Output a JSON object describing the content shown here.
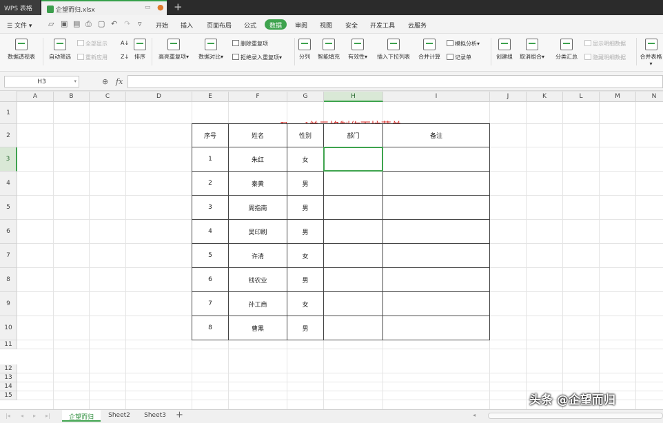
{
  "titlebar": {
    "app_name": "WPS 表格",
    "file_name": "企望而归.xlsx",
    "new_tab": "+"
  },
  "menu": {
    "file_label": "文件",
    "items": [
      "开始",
      "插入",
      "页面布局",
      "公式",
      "数据",
      "审阅",
      "视图",
      "安全",
      "开发工具",
      "云服务"
    ],
    "active": "数据"
  },
  "ribbon": {
    "pivot": "数据透视表",
    "autofilter": "自动筛选",
    "show_all": "全部显示",
    "reapply": "重新应用",
    "sort": "排序",
    "highlight_dup": "高亮重复项",
    "compare": "数据对比",
    "delete_dup": "删除重复项",
    "reject_dup": "拒绝录入重复项",
    "split": "分列",
    "smart_fill": "智能填充",
    "validity": "有效性",
    "insert_dropdown": "插入下拉列表",
    "consolidate": "合并计算",
    "simulate": "模拟分析",
    "record": "记录单",
    "create_group": "创建组",
    "ungroup": "取消组合",
    "subtotal": "分类汇总",
    "show_detail": "显示明细数据",
    "hide_detail": "隐藏明细数据",
    "merge_tables": "合并表格"
  },
  "formula_bar": {
    "cell_ref": "H3",
    "fx": "fx",
    "value": ""
  },
  "columns": [
    "A",
    "B",
    "C",
    "D",
    "E",
    "F",
    "G",
    "H",
    "I",
    "J",
    "K",
    "L",
    "M",
    "N"
  ],
  "rows": [
    "1",
    "2",
    "3",
    "4",
    "5",
    "6",
    "7",
    "8",
    "9",
    "10",
    "11",
    "12",
    "13",
    "14",
    "15"
  ],
  "selected_column": "H",
  "selected_row": "3",
  "table": {
    "title": "Excel单元格制作下拉菜单",
    "headers": [
      "序号",
      "姓名",
      "性别",
      "部门",
      "备注"
    ],
    "rows": [
      [
        "1",
        "朱红",
        "女",
        "",
        ""
      ],
      [
        "2",
        "秦黄",
        "男",
        "",
        ""
      ],
      [
        "3",
        "周指南",
        "男",
        "",
        ""
      ],
      [
        "4",
        "吴印刷",
        "男",
        "",
        ""
      ],
      [
        "5",
        "许清",
        "女",
        "",
        ""
      ],
      [
        "6",
        "钱农业",
        "男",
        "",
        ""
      ],
      [
        "7",
        "孙工商",
        "女",
        "",
        ""
      ],
      [
        "8",
        "曹黑",
        "男",
        "",
        ""
      ]
    ]
  },
  "sheets": [
    "企望而归",
    "Sheet2",
    "Sheet3"
  ],
  "active_sheet": "企望而归",
  "watermark": "头条 @企望而归",
  "colors": {
    "accent": "#3ea34e",
    "title_red": "#d9302c"
  }
}
